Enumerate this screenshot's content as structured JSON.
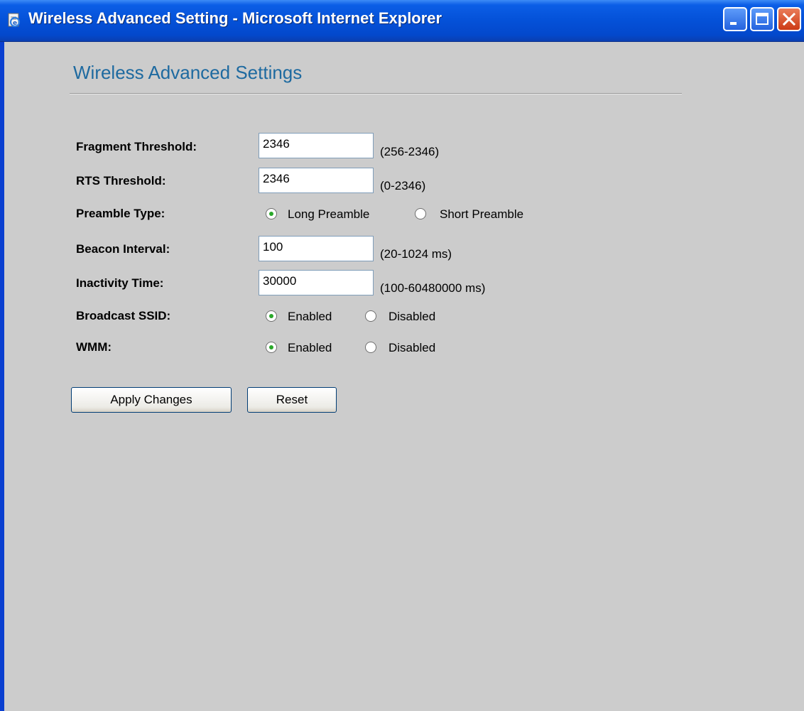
{
  "window": {
    "title": "Wireless Advanced Setting - Microsoft Internet Explorer",
    "icons": {
      "app": "ie-page-icon",
      "minimize": "minimize-icon",
      "maximize": "maximize-icon",
      "close": "close-icon"
    }
  },
  "page": {
    "title": "Wireless Advanced Settings"
  },
  "form": {
    "fragment_threshold": {
      "label": "Fragment Threshold:",
      "value": "2346",
      "hint": "(256-2346)"
    },
    "rts_threshold": {
      "label": "RTS Threshold:",
      "value": "2346",
      "hint": "(0-2346)"
    },
    "preamble_type": {
      "label": "Preamble Type:",
      "options": [
        {
          "label": "Long Preamble",
          "selected": true
        },
        {
          "label": "Short Preamble",
          "selected": false
        }
      ]
    },
    "beacon_interval": {
      "label": "Beacon Interval:",
      "value": "100",
      "hint": "(20-1024 ms)"
    },
    "inactivity_time": {
      "label": "Inactivity Time:",
      "value": "30000",
      "hint": "(100-60480000 ms)"
    },
    "broadcast_ssid": {
      "label": "Broadcast SSID:",
      "options": [
        {
          "label": "Enabled",
          "selected": true
        },
        {
          "label": "Disabled",
          "selected": false
        }
      ]
    },
    "wmm": {
      "label": "WMM:",
      "options": [
        {
          "label": "Enabled",
          "selected": true
        },
        {
          "label": "Disabled",
          "selected": false
        }
      ]
    }
  },
  "buttons": {
    "apply": "Apply Changes",
    "reset": "Reset"
  },
  "colors": {
    "titlebar": "#0451d8",
    "page_background": "#cccccc",
    "heading": "#1e6aa0",
    "radio_dot": "#2aa82a"
  }
}
